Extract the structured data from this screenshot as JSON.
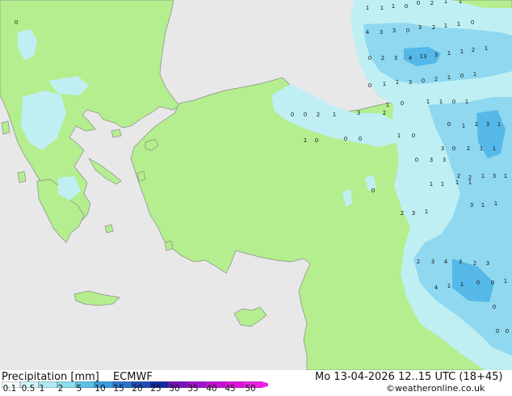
{
  "map": {
    "colors": {
      "sea": "#e8e8e8",
      "land": "#b4ee8e",
      "coast": "#8a8a8a",
      "rain_light": "#bfeff2",
      "rain_mid": "#8fd8ef",
      "rain_heavy": "#55b8e8"
    },
    "precip_values": [
      {
        "v": "1"
      },
      {
        "v": "1"
      },
      {
        "v": "1"
      },
      {
        "v": "0"
      },
      {
        "v": "0"
      },
      {
        "v": "2"
      },
      {
        "v": "1"
      },
      {
        "v": "1"
      },
      {
        "v": "4"
      },
      {
        "v": "3"
      },
      {
        "v": "3"
      },
      {
        "v": "0"
      },
      {
        "v": "3"
      },
      {
        "v": "2"
      },
      {
        "v": "1"
      },
      {
        "v": "1"
      },
      {
        "v": "0"
      },
      {
        "v": "0"
      },
      {
        "v": "2"
      },
      {
        "v": "3"
      },
      {
        "v": "4"
      },
      {
        "v": "13"
      },
      {
        "v": "3"
      },
      {
        "v": "1"
      },
      {
        "v": "1"
      },
      {
        "v": "2"
      },
      {
        "v": "1"
      },
      {
        "v": "0"
      },
      {
        "v": "1"
      },
      {
        "v": "1"
      },
      {
        "v": "3"
      },
      {
        "v": "0"
      },
      {
        "v": "2"
      },
      {
        "v": "1"
      },
      {
        "v": "0"
      },
      {
        "v": "1"
      },
      {
        "v": "1"
      },
      {
        "v": "0"
      },
      {
        "v": "1"
      },
      {
        "v": "1"
      },
      {
        "v": "0"
      },
      {
        "v": "1"
      },
      {
        "v": "0"
      },
      {
        "v": "0"
      },
      {
        "v": "2"
      },
      {
        "v": "1"
      },
      {
        "v": "3"
      },
      {
        "v": "2"
      },
      {
        "v": "1"
      },
      {
        "v": "0"
      },
      {
        "v": "0"
      },
      {
        "v": "0"
      },
      {
        "v": "1"
      },
      {
        "v": "0"
      },
      {
        "v": "0"
      },
      {
        "v": "1"
      },
      {
        "v": "2"
      },
      {
        "v": "3"
      },
      {
        "v": "1"
      },
      {
        "v": "3"
      },
      {
        "v": "0"
      },
      {
        "v": "2"
      },
      {
        "v": "1"
      },
      {
        "v": "1"
      },
      {
        "v": "0"
      },
      {
        "v": "3"
      },
      {
        "v": "3"
      },
      {
        "v": "2"
      },
      {
        "v": "2"
      },
      {
        "v": "1"
      },
      {
        "v": "3"
      },
      {
        "v": "1"
      },
      {
        "v": "0"
      },
      {
        "v": "1"
      },
      {
        "v": "1"
      },
      {
        "v": "1"
      },
      {
        "v": "1"
      },
      {
        "v": "2"
      },
      {
        "v": "3"
      },
      {
        "v": "1"
      },
      {
        "v": "3"
      },
      {
        "v": "1"
      },
      {
        "v": "1"
      },
      {
        "v": "2"
      },
      {
        "v": "3"
      },
      {
        "v": "4"
      },
      {
        "v": "3"
      },
      {
        "v": "2"
      },
      {
        "v": "3"
      },
      {
        "v": "4"
      },
      {
        "v": "1"
      },
      {
        "v": "1"
      },
      {
        "v": "0"
      },
      {
        "v": "0"
      },
      {
        "v": "1"
      },
      {
        "v": "0"
      },
      {
        "v": "0"
      },
      {
        "v": "0"
      },
      {
        "v": "0"
      }
    ]
  },
  "footer": {
    "title": "Precipitation [mm]",
    "model": "ECMWF",
    "datetime": "Mo 13-04-2026 12..15 UTC (18+45)",
    "credit": "©weatheronline.co.uk",
    "legend_ticks": [
      "0.1",
      "0.5",
      "1",
      "2",
      "5",
      "10",
      "15",
      "20",
      "25",
      "30",
      "35",
      "40",
      "45",
      "50"
    ],
    "legend_colors": [
      "#f5fdfd",
      "#d2f5f7",
      "#aeeaf2",
      "#8ddcf0",
      "#5cc2ea",
      "#3a9ee0",
      "#2a74cc",
      "#1c4fb8",
      "#102aa0",
      "#7a10c0",
      "#a410d0",
      "#c810d8",
      "#e410e0",
      "#f020e8"
    ]
  }
}
